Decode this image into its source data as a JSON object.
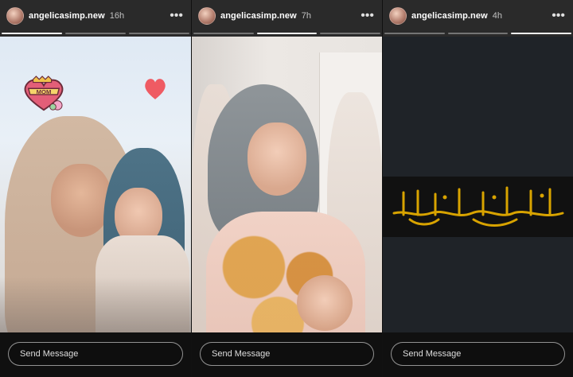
{
  "stories": [
    {
      "username": "angelicasimp.new",
      "time": "16h",
      "more_label": "•••",
      "send_placeholder": "Send Message",
      "stickers": {
        "mom_text": "MOM"
      },
      "progress_total": 3,
      "progress_active_index": 0
    },
    {
      "username": "angelicasimp.new",
      "time": "7h",
      "more_label": "•••",
      "send_placeholder": "Send Message",
      "progress_total": 3,
      "progress_active_index": 1
    },
    {
      "username": "angelicasimp.new",
      "time": "4h",
      "more_label": "•••",
      "send_placeholder": "Send Message",
      "progress_total": 3,
      "progress_active_index": 2
    }
  ],
  "colors": {
    "heart": "#ef5b63",
    "gold": "#d8a300",
    "dark_panel": "#1f2328"
  },
  "icons": {
    "more": "more-icon",
    "heart": "heart-icon",
    "mom_sticker": "mom-heart-sticker-icon"
  }
}
